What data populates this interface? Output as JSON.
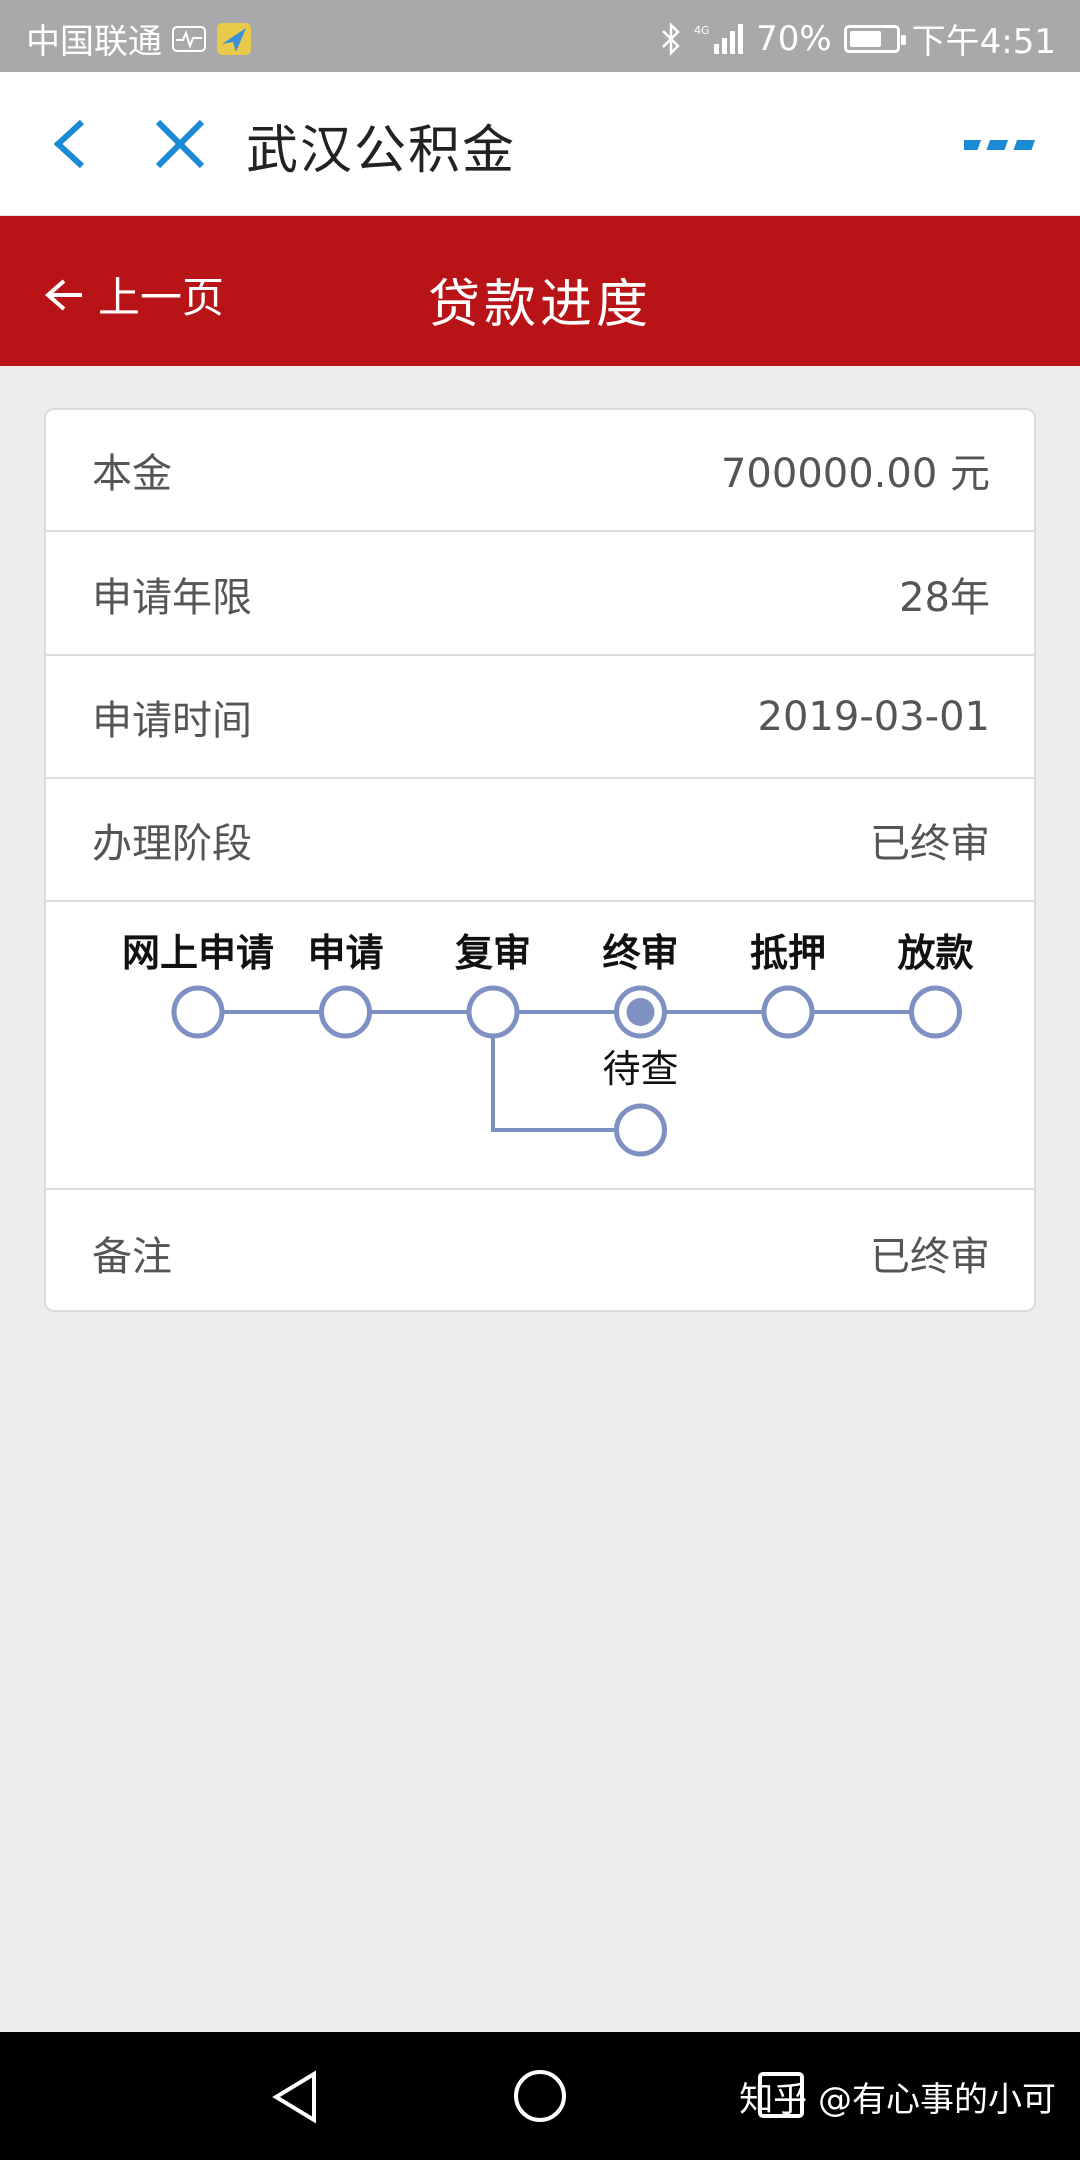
{
  "status_bar": {
    "carrier": "中国联通",
    "battery_percent": "70%",
    "battery_level": 0.7,
    "time": "下午4:51",
    "network": "4G",
    "icons": [
      "activity-icon",
      "app-notification-icon",
      "bluetooth-icon",
      "signal-icon",
      "battery-icon"
    ]
  },
  "app_header": {
    "title": "武汉公积金",
    "icons": {
      "back": "chevron-left-icon",
      "close": "close-icon",
      "more": "more-icon"
    },
    "accent_color": "#1a8ad4"
  },
  "page_bar": {
    "prev_label": "上一页",
    "title": "贷款进度",
    "background_color": "#b81417"
  },
  "details": {
    "principal": {
      "label": "本金",
      "value": "700000.00 元"
    },
    "term": {
      "label": "申请年限",
      "value": "28年"
    },
    "apply_date": {
      "label": "申请时间",
      "value": "2019-03-01"
    },
    "stage": {
      "label": "办理阶段",
      "value": "已终审"
    },
    "remark": {
      "label": "备注",
      "value": "已终审"
    }
  },
  "progress": {
    "steps": [
      {
        "label": "网上申请",
        "active": false
      },
      {
        "label": "申请",
        "active": false
      },
      {
        "label": "复审",
        "active": false
      },
      {
        "label": "终审",
        "active": true
      },
      {
        "label": "抵押",
        "active": false
      },
      {
        "label": "放款",
        "active": false
      }
    ],
    "branch": {
      "label": "待查",
      "from_step": "复审"
    },
    "line_color": "#7f90c2"
  },
  "bottom_nav": {
    "icons": [
      "nav-back-icon",
      "nav-home-icon",
      "nav-recent-icon"
    ],
    "watermark": "知乎 @有心事的小可"
  }
}
